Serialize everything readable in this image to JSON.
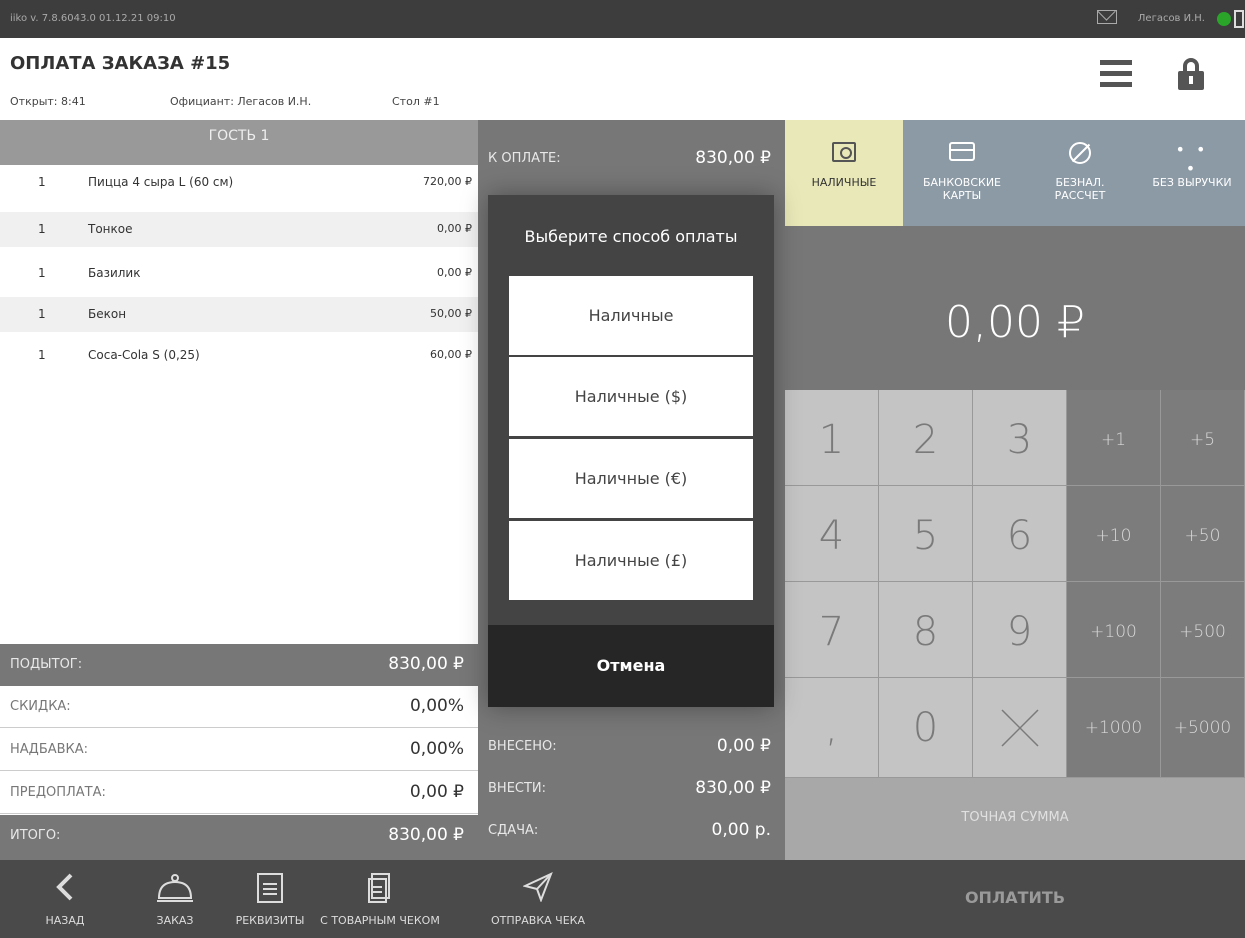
{
  "statusbar": {
    "version": "iiko v. 7.8.6043.0   01.12.21  09:10",
    "user": "Легасов И.Н."
  },
  "header": {
    "title": "ОПЛАТА ЗАКАЗА #15",
    "opened": "Открыт: 8:41",
    "waiter": "Официант: Легасов И.Н.",
    "table": "Стол #1"
  },
  "order": {
    "guest": "ГОСТЬ 1",
    "items": [
      {
        "qty": "1",
        "name": "Пицца 4 сыра L (60 см)",
        "price": "720,00 ₽"
      },
      {
        "qty": "1",
        "name": "Тонкое",
        "price": "0,00 ₽"
      },
      {
        "qty": "1",
        "name": "Базилик",
        "price": "0,00 ₽"
      },
      {
        "qty": "1",
        "name": "Бекон",
        "price": "50,00 ₽"
      },
      {
        "qty": "1",
        "name": "Coca-Cola S (0,25)",
        "price": "60,00 ₽"
      }
    ]
  },
  "totals": {
    "subtotal_label": "ПОДЫТОГ:",
    "subtotal": "830,00 ₽",
    "discount_label": "СКИДКА:",
    "discount": "0,00%",
    "surcharge_label": "НАДБАВКА:",
    "surcharge": "0,00%",
    "prepay_label": "ПРЕДОПЛАТА:",
    "prepay": "0,00 ₽",
    "total_label": "ИТОГО:",
    "total": "830,00 ₽"
  },
  "payment": {
    "to_pay_label": "К ОПЛАТЕ:",
    "to_pay": "830,00 ₽",
    "paid_label": "ВНЕСЕНО:",
    "paid": "0,00 ₽",
    "due_label": "ВНЕСТИ:",
    "due": "830,00 ₽",
    "change_label": "СДАЧА:",
    "change": "0,00 р.",
    "amount": "0,00 ₽"
  },
  "paytabs": [
    {
      "label": "НАЛИЧНЫЕ",
      "icon": "cash-icon"
    },
    {
      "label": "БАНКОВСКИЕ КАРТЫ",
      "icon": "card-icon"
    },
    {
      "label": "БЕЗНАЛ. РАССЧЕТ",
      "icon": "cashless-icon"
    },
    {
      "label": "БЕЗ ВЫРУЧКИ",
      "icon": "more-icon",
      "glyph": "• • •"
    }
  ],
  "keypad": {
    "digits": [
      "1",
      "2",
      "3",
      "4",
      "5",
      "6",
      "7",
      "8",
      "9",
      ",",
      "0"
    ],
    "increments": [
      "+1",
      "+5",
      "+10",
      "+50",
      "+100",
      "+500",
      "+1000",
      "+5000"
    ],
    "exact": "ТОЧНАЯ СУММА"
  },
  "bottombar": {
    "back": "НАЗАД",
    "order": "ЗАКАЗ",
    "requisites": "РЕКВИЗИТЫ",
    "with_receipt": "С ТОВАРНЫМ ЧЕКОМ",
    "send_receipt": "ОТПРАВКА ЧЕКА",
    "pay": "ОПЛАТИТЬ"
  },
  "modal": {
    "title": "Выберите способ оплаты",
    "options": [
      "Наличные",
      "Наличные ($)",
      "Наличные (€)",
      "Наличные (£)"
    ],
    "cancel": "Отмена"
  },
  "colors": {
    "active_tab": "#e8e8b8",
    "tab": "#8c9aa6",
    "panel": "#777777",
    "modal": "#444444"
  }
}
